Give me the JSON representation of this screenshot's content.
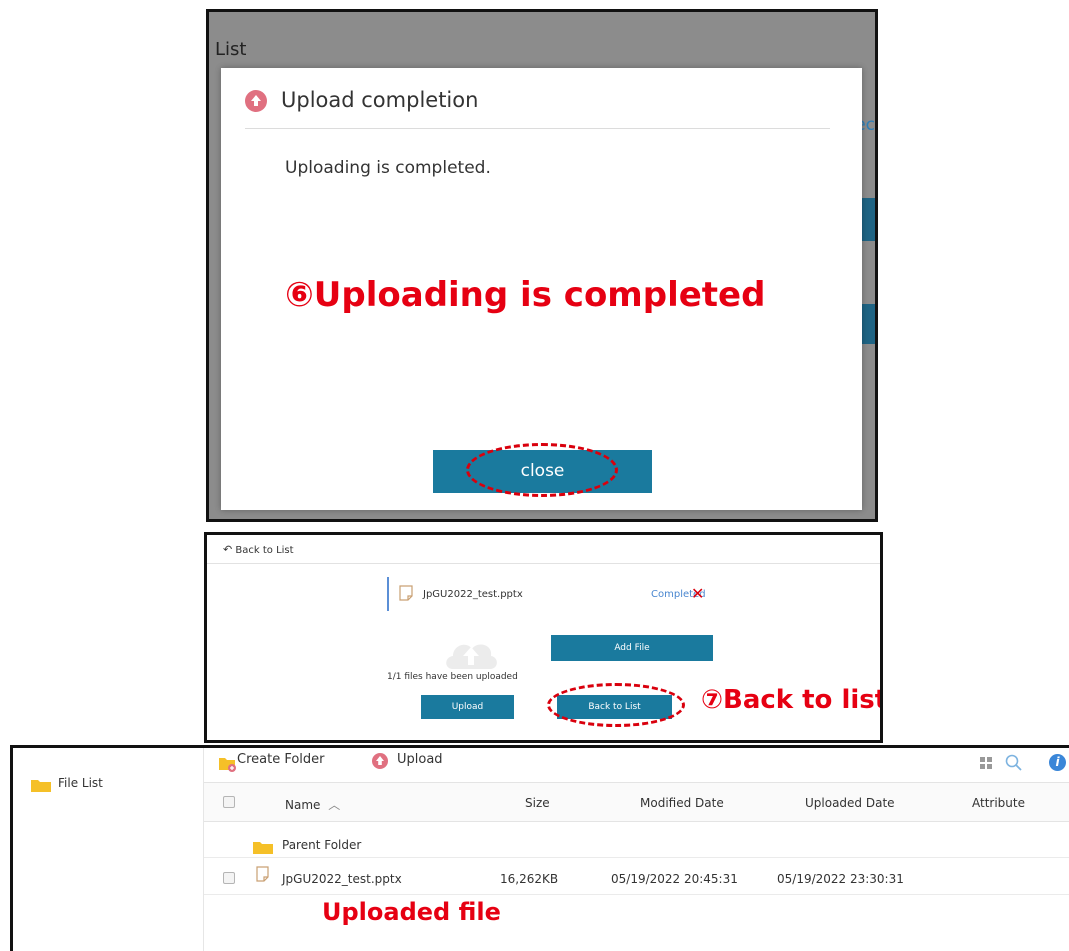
{
  "dialog_screen": {
    "background_title": "List",
    "background_partial_text": "ec",
    "dialog_title": "Upload completion",
    "message": "Uploading is completed.",
    "close_label": "close",
    "annotation": "⑥Uploading is completed"
  },
  "upload_screen": {
    "back_to_list_link": "Back to List",
    "file_name": "JpGU2022_test.pptx",
    "file_status": "Completed",
    "remove_glyph": "✕",
    "add_file_label": "Add File",
    "uploaded_count": "1/1 files have been uploaded",
    "upload_label": "Upload",
    "back_to_list_label": "Back to List",
    "annotation": "⑦Back to list"
  },
  "file_list": {
    "sidebar_label": "File List",
    "create_folder_label": "Create Folder",
    "upload_label": "Upload",
    "info_glyph": "i",
    "columns": {
      "name": "Name",
      "sort_glyph": "︿",
      "size": "Size",
      "modified": "Modified Date",
      "uploaded": "Uploaded Date",
      "attribute": "Attribute"
    },
    "parent_folder_label": "Parent Folder",
    "rows": [
      {
        "name": "JpGU2022_test.pptx",
        "size": "16,262KB",
        "modified": "05/19/2022 20:45:31",
        "uploaded": "05/19/2022 23:30:31",
        "attribute": ""
      }
    ],
    "annotation": "Uploaded file"
  },
  "colors": {
    "annotation_red": "#e60012",
    "button_teal": "#1a7a9e",
    "upload_icon_red": "#e07080",
    "folder_yellow": "#f5c028",
    "info_blue": "#3a86d8"
  }
}
